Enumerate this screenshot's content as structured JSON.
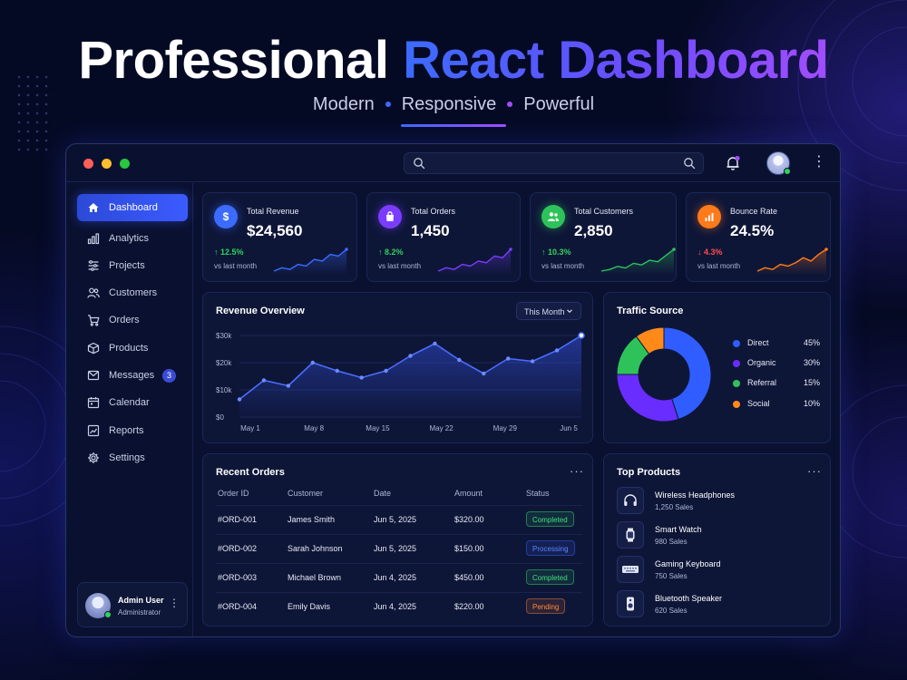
{
  "hero": {
    "title_white": "Professional",
    "title_gradient": "React Dashboard",
    "subtitle": [
      "Modern",
      "Responsive",
      "Powerful"
    ]
  },
  "colors": {
    "accent_blue": "#3b5bff",
    "accent_purple": "#8b4dff",
    "green": "#2fd35b",
    "orange": "#ff8a2a",
    "red": "#ff4d4d",
    "traffic_light_red": "#ff5f57",
    "traffic_light_yellow": "#febc2e",
    "traffic_light_green": "#28c840"
  },
  "topbar": {
    "search_placeholder": ""
  },
  "sidebar": {
    "items": [
      {
        "label": "Dashboard",
        "icon": "home-icon",
        "active": true
      },
      {
        "label": "Analytics",
        "icon": "bar-chart-icon"
      },
      {
        "label": "Projects",
        "icon": "projects-icon"
      },
      {
        "label": "Customers",
        "icon": "users-icon"
      },
      {
        "label": "Orders",
        "icon": "cart-icon"
      },
      {
        "label": "Products",
        "icon": "box-icon"
      },
      {
        "label": "Messages",
        "icon": "mail-icon",
        "badge": "3"
      },
      {
        "label": "Calendar",
        "icon": "calendar-icon"
      },
      {
        "label": "Reports",
        "icon": "report-icon"
      },
      {
        "label": "Settings",
        "icon": "gear-icon"
      }
    ],
    "user": {
      "name": "Admin User",
      "role": "Administrator"
    }
  },
  "stats": [
    {
      "label": "Total Revenue",
      "value": "$24,560",
      "change": "12.5%",
      "direction": "up",
      "sub": "vs last month",
      "icon": "dollar-icon",
      "color": "#3b6bff",
      "spark": [
        4,
        6,
        5,
        8,
        7,
        11,
        10,
        14,
        13,
        17
      ]
    },
    {
      "label": "Total Orders",
      "value": "1,450",
      "change": "8.2%",
      "direction": "up",
      "sub": "vs last month",
      "icon": "bag-icon",
      "color": "#7a3dff",
      "spark": [
        3,
        5,
        4,
        7,
        6,
        9,
        8,
        12,
        11,
        16
      ]
    },
    {
      "label": "Total Customers",
      "value": "2,850",
      "change": "10.3%",
      "direction": "up",
      "sub": "vs last month",
      "icon": "customers-icon",
      "color": "#2ec35a",
      "spark": [
        3,
        4,
        6,
        5,
        8,
        7,
        10,
        9,
        13,
        17
      ]
    },
    {
      "label": "Bounce Rate",
      "value": "24.5%",
      "change": "4.3%",
      "direction": "down",
      "sub": "vs last month",
      "icon": "chart-icon",
      "color": "#ff7a1a",
      "spark": [
        4,
        6,
        5,
        8,
        7,
        9,
        12,
        10,
        14,
        17
      ]
    }
  ],
  "revenue": {
    "title": "Revenue Overview",
    "range": "This Month"
  },
  "chart_data": [
    {
      "type": "area",
      "title": "Revenue Overview",
      "xlabel": "",
      "ylabel": "",
      "x_ticks": [
        "May 1",
        "May 8",
        "May 15",
        "May 22",
        "May 29",
        "Jun 5"
      ],
      "y_ticks": [
        "$0",
        "$10k",
        "$20k",
        "$30k"
      ],
      "ylim": [
        0,
        30000
      ],
      "x": [
        0,
        1,
        2,
        3,
        4,
        5,
        6,
        7,
        8,
        9,
        10,
        11,
        12,
        13,
        14
      ],
      "values": [
        6500,
        13500,
        11500,
        20000,
        17000,
        14500,
        17000,
        22500,
        27000,
        21000,
        16000,
        21500,
        20500,
        24500,
        30000
      ],
      "grid": true
    },
    {
      "type": "pie",
      "title": "Traffic Source",
      "categories": [
        "Direct",
        "Organic",
        "Referral",
        "Social"
      ],
      "values": [
        45,
        30,
        15,
        10
      ],
      "labels": [
        "45%",
        "30%",
        "15%",
        "10%"
      ],
      "colors": [
        "#2f5dff",
        "#6a2dff",
        "#2ec35a",
        "#ff8a1a"
      ],
      "legend": "right"
    }
  ],
  "orders": {
    "title": "Recent Orders",
    "columns": [
      "Order ID",
      "Customer",
      "Date",
      "Amount",
      "Status"
    ],
    "rows": [
      {
        "id": "#ORD-001",
        "customer": "James Smith",
        "date": "Jun 5, 2025",
        "amount": "$320.00",
        "status": "Completed",
        "kind": "completed"
      },
      {
        "id": "#ORD-002",
        "customer": "Sarah Johnson",
        "date": "Jun 5, 2025",
        "amount": "$150.00",
        "status": "Processing",
        "kind": "processing"
      },
      {
        "id": "#ORD-003",
        "customer": "Michael Brown",
        "date": "Jun 4, 2025",
        "amount": "$450.00",
        "status": "Completed",
        "kind": "completed"
      },
      {
        "id": "#ORD-004",
        "customer": "Emily Davis",
        "date": "Jun 4, 2025",
        "amount": "$220.00",
        "status": "Pending",
        "kind": "pending"
      }
    ]
  },
  "products": {
    "title": "Top Products",
    "items": [
      {
        "name": "Wireless Headphones",
        "sales": "1,250 Sales",
        "icon": "headphones-icon"
      },
      {
        "name": "Smart Watch",
        "sales": "980 Sales",
        "icon": "watch-icon"
      },
      {
        "name": "Gaming Keyboard",
        "sales": "750 Sales",
        "icon": "keyboard-icon"
      },
      {
        "name": "Bluetooth Speaker",
        "sales": "620 Sales",
        "icon": "speaker-icon"
      }
    ]
  }
}
